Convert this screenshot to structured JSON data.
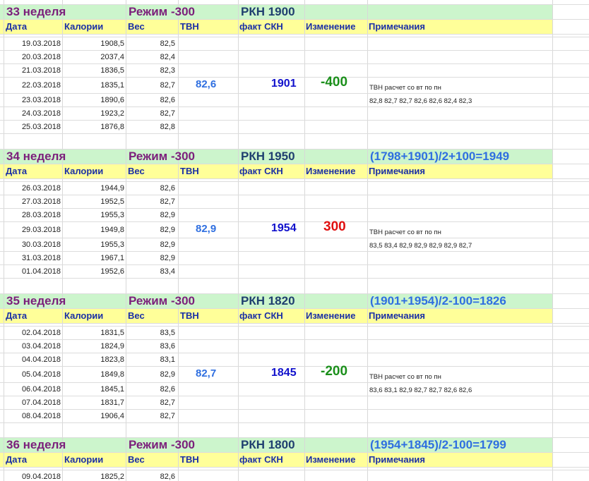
{
  "columns": {
    "date": "Дата",
    "calories": "Калории",
    "weight": "Вес",
    "tvn": "ТВН",
    "fact": "факт СКН",
    "change": "Изменение",
    "notes": "Примечания"
  },
  "weeks": [
    {
      "week": "33 неделя",
      "mode": "Режим -300",
      "rkn": "РКН 1900",
      "formula": "",
      "tvn": "82,6",
      "fact": "1901",
      "change": "-400",
      "note1": "ТВН расчет со вт по пн",
      "note2": "82,8 82,7 82,7 82,6 82,6 82,4 82,3",
      "rows": [
        {
          "date": "19.03.2018",
          "cal": "1908,5",
          "w": "82,5"
        },
        {
          "date": "20.03.2018",
          "cal": "2037,4",
          "w": "82,4"
        },
        {
          "date": "21.03.2018",
          "cal": "1836,5",
          "w": "82,3"
        },
        {
          "date": "22.03.2018",
          "cal": "1835,1",
          "w": "82,7"
        },
        {
          "date": "23.03.2018",
          "cal": "1890,6",
          "w": "82,6"
        },
        {
          "date": "24.03.2018",
          "cal": "1923,2",
          "w": "82,7"
        },
        {
          "date": "25.03.2018",
          "cal": "1876,8",
          "w": "82,8"
        }
      ]
    },
    {
      "week": "34 неделя",
      "mode": "Режим -300",
      "rkn": "РКН 1950",
      "formula": "(1798+1901)/2+100=1949",
      "tvn": "82,9",
      "fact": "1954",
      "change": "300",
      "note1": "ТВН расчет со вт по пн",
      "note2": "83,5 83,4 82,9 82,9 82,9 82,9 82,7",
      "rows": [
        {
          "date": "26.03.2018",
          "cal": "1944,9",
          "w": "82,6"
        },
        {
          "date": "27.03.2018",
          "cal": "1952,5",
          "w": "82,7"
        },
        {
          "date": "28.03.2018",
          "cal": "1955,3",
          "w": "82,9"
        },
        {
          "date": "29.03.2018",
          "cal": "1949,8",
          "w": "82,9"
        },
        {
          "date": "30.03.2018",
          "cal": "1955,3",
          "w": "82,9"
        },
        {
          "date": "31.03.2018",
          "cal": "1967,1",
          "w": "82,9"
        },
        {
          "date": "01.04.2018",
          "cal": "1952,6",
          "w": "83,4"
        }
      ]
    },
    {
      "week": "35 неделя",
      "mode": "Режим -300",
      "rkn": "РКН 1820",
      "formula": "(1901+1954)/2-100=1826",
      "tvn": "82,7",
      "fact": "1845",
      "change": "-200",
      "note1": "ТВН расчет со вт по пн",
      "note2": "83,6 83,1 82,9 82,7 82,7 82,6 82,6",
      "rows": [
        {
          "date": "02.04.2018",
          "cal": "1831,5",
          "w": "83,5"
        },
        {
          "date": "03.04.2018",
          "cal": "1824,9",
          "w": "83,6"
        },
        {
          "date": "04.04.2018",
          "cal": "1823,8",
          "w": "83,1"
        },
        {
          "date": "05.04.2018",
          "cal": "1849,8",
          "w": "82,9"
        },
        {
          "date": "06.04.2018",
          "cal": "1845,1",
          "w": "82,6"
        },
        {
          "date": "07.04.2018",
          "cal": "1831,7",
          "w": "82,7"
        },
        {
          "date": "08.04.2018",
          "cal": "1906,4",
          "w": "82,7"
        }
      ]
    },
    {
      "week": "36 неделя",
      "mode": "Режим -300",
      "rkn": "РКН 1800",
      "formula": "(1954+1845)/2-100=1799",
      "tvn": "",
      "fact": "",
      "change": "",
      "note1": "",
      "note2": "",
      "rows": [
        {
          "date": "09.04.2018",
          "cal": "1825,2",
          "w": "82,6"
        }
      ]
    }
  ]
}
